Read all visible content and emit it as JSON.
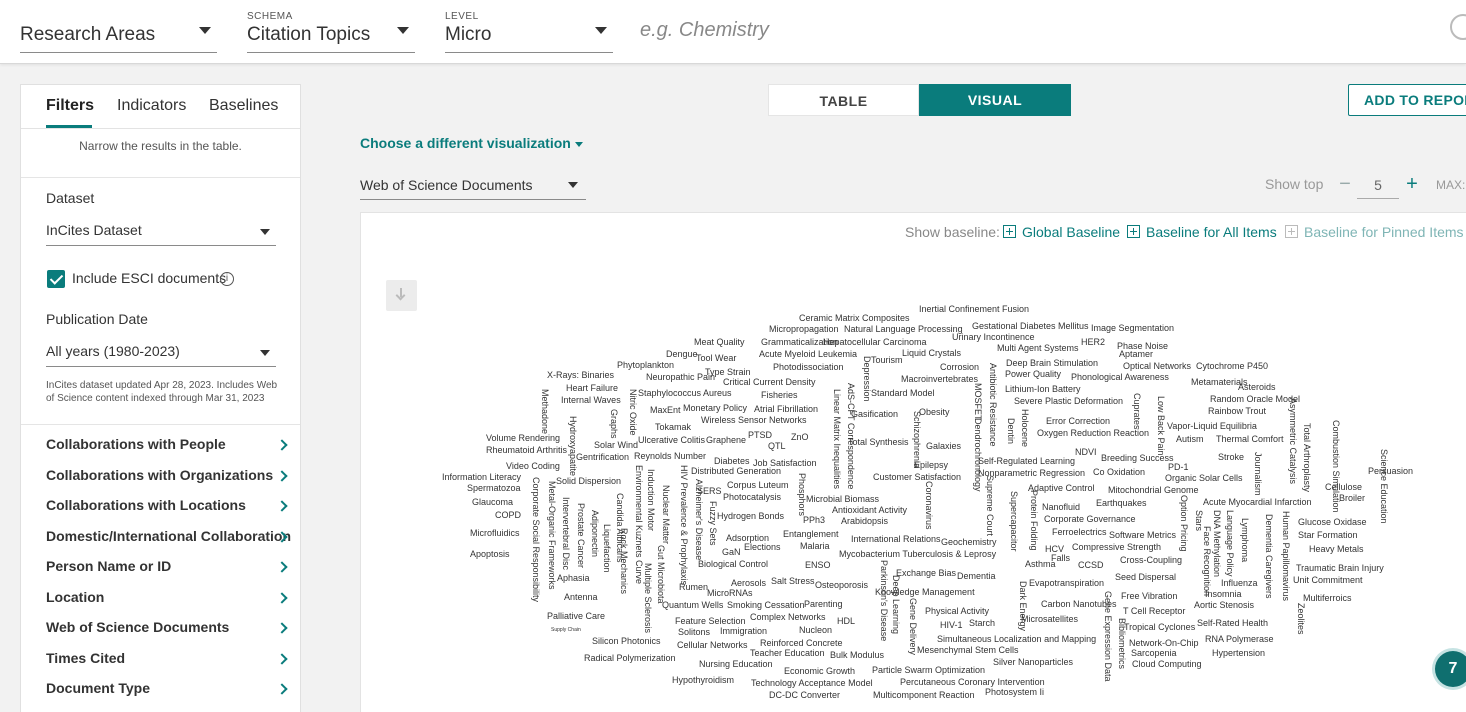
{
  "header": {
    "research_areas": {
      "value": "Research Areas"
    },
    "schema": {
      "label": "SCHEMA",
      "value": "Citation Topics"
    },
    "level": {
      "label": "LEVEL",
      "value": "Micro"
    },
    "search": {
      "placeholder": "e.g. Chemistry"
    }
  },
  "sidebar": {
    "tabs": [
      {
        "label": "Filters",
        "active": true
      },
      {
        "label": "Indicators"
      },
      {
        "label": "Baselines"
      }
    ],
    "narrow_text": "Narrow the results in the table.",
    "dataset": {
      "label": "Dataset",
      "value": "InCites Dataset"
    },
    "include_esci": {
      "label": "Include ESCI documents",
      "checked": true,
      "info_icon": "i"
    },
    "publication_date": {
      "label": "Publication Date",
      "value": "All years (1980-2023)"
    },
    "note": "InCites dataset updated Apr 28, 2023. Includes Web of Science content indexed through Mar 31, 2023",
    "filters": [
      "Collaborations with People",
      "Collaborations with Organizations",
      "Collaborations with Locations",
      "Domestic/International Collaboration",
      "Person Name or ID",
      "Location",
      "Web of Science Documents",
      "Times Cited",
      "Document Type"
    ]
  },
  "main": {
    "toggle": {
      "table": "TABLE",
      "visual": "VISUAL",
      "active": "VISUAL"
    },
    "add_to_report": "ADD TO REPORT",
    "choose_viz": "Choose a different visualization",
    "metric_select": "Web of Science Documents",
    "show_top": {
      "label": "Show top",
      "minus": "−",
      "value": "5",
      "plus": "+",
      "max_label": "MAX:"
    },
    "baseline": {
      "label": "Show baseline:",
      "items": [
        "Global Baseline",
        "Baseline for All Items",
        "Baseline for Pinned Items"
      ]
    },
    "chat_badge": "7",
    "colors": {
      "accent": "#0a7c7c"
    }
  },
  "word_cloud": {
    "horizontal": [
      "Inertial Confinement Fusion",
      "Ceramic Matrix Composites",
      "Micropropagation",
      "Natural Language Processing",
      "Gestational Diabetes Mellitus",
      "Image Segmentation",
      "Grammaticalization",
      "Hepatocellular Carcinoma",
      "Urinary Incontinence",
      "HER2",
      "Phase Noise",
      "Meat Quality",
      "Acute Myeloid Leukemia",
      "Liquid Crystals",
      "Multi Agent Systems",
      "Aptamer",
      "Dengue",
      "Tool Wear",
      "Tourism",
      "Deep Brain Stimulation",
      "Optical Networks",
      "Cytochrome P450",
      "Phytoplankton",
      "Photodissociation",
      "Corrosion",
      "X-Rays: Binaries",
      "Neuropathic Pain",
      "Type Strain",
      "Power Quality",
      "Phonological Awareness",
      "Critical Current Density",
      "Macroinvertebrates",
      "Metamaterials",
      "Heart Failure",
      "Staphylococcus Aureus",
      "Fisheries",
      "Standard Model",
      "Lithium-Ion Battery",
      "Asteroids",
      "Internal Waves",
      "Severe Plastic Deformation",
      "MaxEnt",
      "Monetary Policy",
      "Atrial Fibrillation",
      "Random Oracle Model",
      "Gasification",
      "Obesity",
      "Rainbow Trout",
      "Wireless Sensor Networks",
      "Error Correction",
      "Tokamak",
      "Vapor-Liquid Equilibria",
      "PTSD",
      "Oxygen Reduction Reaction",
      "ZnO",
      "Volume Rendering",
      "Ulcerative Colitis",
      "Graphene",
      "Autism",
      "Thermal Comfort",
      "QTL",
      "Total Synthesis",
      "Galaxies",
      "Rheumatoid Arthritis",
      "Solar Wind",
      "NDVI",
      "Gentrification",
      "Reynolds Number",
      "Diabetes",
      "Job Satisfaction",
      "Breeding Success",
      "Stroke",
      "Self-Regulated Learning",
      "Video Coding",
      "Epilepsy",
      "PD-1",
      "Persuasion",
      "Distributed Generation",
      "Nonparametric Regression",
      "Co Oxidation",
      "Information Literacy",
      "Solid Dispersion",
      "Customer Satisfaction",
      "Organic Solar Cells",
      "Corpus Luteum",
      "Adaptive Control",
      "Mitochondrial Genome",
      "Cellulose",
      "Spermatozoa",
      "SERS",
      "Photocatalysis",
      "Microbial Biomass",
      "Broiler",
      "Glaucoma",
      "Earthquakes",
      "Acute Myocardial Infarction",
      "Antioxidant Activity",
      "Nanofluid",
      "COPD",
      "Hydrogen Bonds",
      "PPh3",
      "Arabidopsis",
      "Corporate Governance",
      "Glucose Oxidase",
      "Entanglement",
      "Ferroelectrics",
      "Microfluidics",
      "Adsorption",
      "Software Metrics",
      "Star Formation",
      "International Relations",
      "Geochemistry",
      "Elections",
      "Malaria",
      "Compressive Strength",
      "Heavy Metals",
      "GaN",
      "HCV",
      "Apoptosis",
      "Mycobacterium Tuberculosis & Leprosy",
      "Falls",
      "Cross-Coupling",
      "Biological Control",
      "ENSO",
      "Asthma",
      "CCSD",
      "Traumatic Brain Injury",
      "Exchange Bias",
      "Dementia",
      "Aphasia",
      "Seed Dispersal",
      "Unit Commitment",
      "Salt Stress",
      "Aerosols",
      "Osteoporosis",
      "Evapotranspiration",
      "Influenza",
      "Rumen",
      "Knowledge Management",
      "Insomnia",
      "Antenna",
      "MicroRNAs",
      "Free Vibration",
      "Multiferroics",
      "Quantum Wells",
      "Smoking Cessation",
      "Parenting",
      "Carbon Nanotubes",
      "Aortic Stenosis",
      "Physical Activity",
      "T Cell Receptor",
      "Palliative Care",
      "Complex Networks",
      "Microsatellites",
      "Feature Selection",
      "HDL",
      "HIV-1",
      "Starch",
      "Self-Rated Health",
      "Supply Chain",
      "Immigration",
      "Tropical Cyclones",
      "Solitons",
      "Nucleon",
      "Silicon Photonics",
      "Cellular Networks",
      "Simultaneous Localization and Mapping",
      "RNA Polymerase",
      "Reinforced Concrete",
      "Network-On-Chip",
      "Mesenchymal Stem Cells",
      "Teacher Education",
      "Bulk Modulus",
      "Sarcopenia",
      "Hypertension",
      "Radical Polymerization",
      "Silver Nanoparticles",
      "Nursing Education",
      "Cloud Computing",
      "Economic Growth",
      "Particle Swarm Optimization",
      "Hypothyroidism",
      "Technology Acceptance Model",
      "Percutaneous Coronary Intervention",
      "Photosystem Ii",
      "DC-DC Converter",
      "Multicomponent Reaction"
    ],
    "vertical": [
      "Methadone",
      "Hydroxyapatite",
      "Graphs",
      "Nitric Oxide",
      "Depression",
      "AdS-CFT Correspondence",
      "Linear Matrix Inequalities",
      "Antibiotic Resistance",
      "MOSFET",
      "Dendrochronology",
      "Dentin",
      "Holocene",
      "Low Back Pain",
      "Cuprates",
      "Asymmetric Catalysis",
      "Total Arthroplasty",
      "Combustion Simulation",
      "Science Education",
      "Schizophrenia",
      "Journalism",
      "Corporate Social Responsibility",
      "Metal-Organic Frameworks",
      "Intervertebral Disc",
      "Prostate Cancer",
      "Adiponectin",
      "Liquefaction",
      "Candida Albicans",
      "Environmental Kuznets Curve",
      "Induction Motor",
      "Rock Mechanics",
      "Multiple Sclerosis",
      "Gut Microbiota",
      "Nuclear Matter",
      "HIV Prevalence & Prophylaxis",
      "Alzheimer's Disease",
      "Fuzzy Sets",
      "Phosphors",
      "Coronavirus",
      "Supreme Court",
      "Supercapacitor",
      "Protein Folding",
      "Option Pricing",
      "Stars",
      "Face Recognition",
      "DNA Methylation",
      "Language Policy",
      "Lymphoma",
      "Dementia Caregivers",
      "Human Papillomavirus",
      "Zeolites",
      "Parkinson's Disease",
      "Deep Learning",
      "Gene Delivery",
      "Dark Energy",
      "Gene Expression Data",
      "Bibliometrics"
    ]
  }
}
